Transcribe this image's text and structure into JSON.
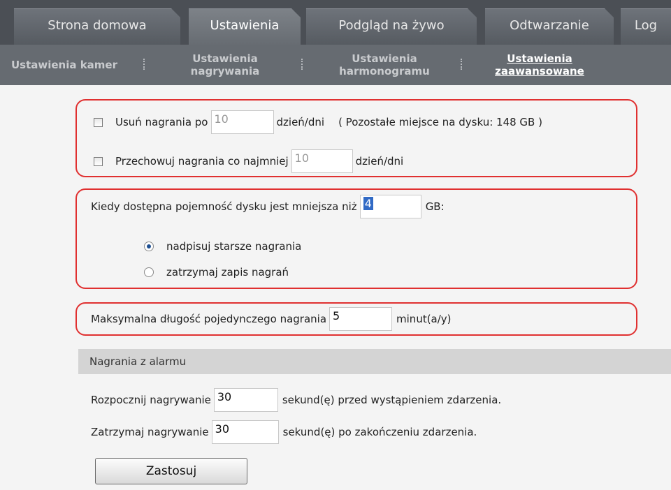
{
  "tabs": [
    {
      "label": "Strona domowa",
      "active": false
    },
    {
      "label": "Ustawienia",
      "active": true
    },
    {
      "label": "Podgląd na żywo",
      "active": false
    },
    {
      "label": "Odtwarzanie",
      "active": false
    },
    {
      "label": "Log",
      "active": false
    }
  ],
  "subnav": [
    {
      "label": "Ustawienia kamer",
      "active": false
    },
    {
      "label": "Ustawienia nagrywania",
      "active": false
    },
    {
      "label": "Ustawienia harmonogramu",
      "active": false
    },
    {
      "label": "Ustawienia zaawansowane",
      "active": true
    }
  ],
  "retention": {
    "delete_label": "Usuń nagrania po",
    "delete_value": "10",
    "delete_unit": "dzień/dni",
    "free_space_text": "( Pozostałe miejsce na dysku:  148 GB )",
    "keep_label": "Przechowuj nagrania co najmniej",
    "keep_value": "10",
    "keep_unit": "dzień/dni"
  },
  "low_disk": {
    "label": "Kiedy dostępna pojemność dysku jest mniejsza niż",
    "value": "4",
    "unit": "GB:",
    "option_overwrite": "nadpisuj starsze nagrania",
    "option_stop": "zatrzymaj zapis nagrań",
    "selected": "overwrite"
  },
  "max_length": {
    "label": "Maksymalna długość pojedynczego nagrania",
    "value": "5",
    "unit": "minut(a/y)"
  },
  "alarm": {
    "section_title": "Nagrania z alarmu",
    "pre_label": "Rozpocznij nagrywanie",
    "pre_value": "30",
    "pre_unit": "sekund(ę) przed wystąpieniem zdarzenia.",
    "post_label": "Zatrzymaj nagrywanie",
    "post_value": "30",
    "post_unit": "sekund(ę) po zakończeniu zdarzenia."
  },
  "apply_label": "Zastosuj",
  "colors": {
    "highlight_border": "#e03030",
    "tab_bg": "#565b61",
    "submenu_bg": "#666b71"
  }
}
